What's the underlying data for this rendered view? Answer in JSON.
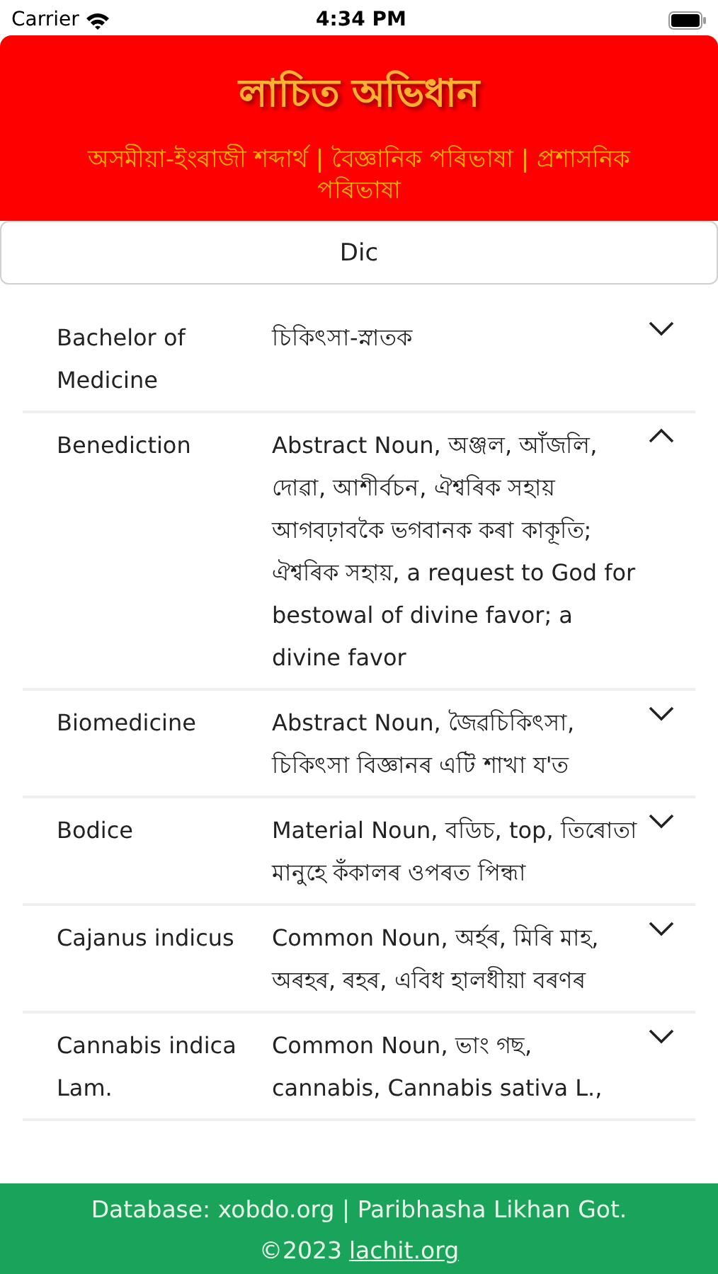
{
  "status_bar": {
    "carrier": "Carrier",
    "time": "4:34 PM"
  },
  "header": {
    "title": "লাচিত অভিধান",
    "subtitle": "অসমীয়া-ইংৰাজী শব্দাৰ্থ | বৈজ্ঞানিক পৰিভাষা | প্ৰশাসনিক পৰিভাষা"
  },
  "mode_button": {
    "label": "Dic"
  },
  "entries": [
    {
      "term": "Bachelor of Medicine",
      "definition": "চিকিৎসা-স্নাতক",
      "expanded": false
    },
    {
      "term": "Benediction",
      "definition": "Abstract Noun, অঞ্জল, আঁজলি, দোৱা, আশীৰ্বচন, ঐশ্বৰিক সহায় আগবঢ়াবকৈ ভগবানক কৰা কাকূতি; ঐশ্বৰিক সহায়, a request to God for bestowal of divine favor; a divine favor",
      "expanded": true
    },
    {
      "term": "Biomedicine",
      "definition": "Abstract Noun, জৈৱচিকিৎসা, চিকিৎসা বিজ্ঞানৰ এটি শাখা য'ত",
      "expanded": false
    },
    {
      "term": "Bodice",
      "definition": "Material Noun, বডিচ, top, তিৰোতা মানুহে কঁকালৰ ওপৰত পিন্ধা",
      "expanded": false
    },
    {
      "term": "Cajanus indicus",
      "definition": "Common Noun, অৰ্হৰ, মিৰি মাহ, অৰহৰ, ৰহৰ, এবিধ হালধীয়া বৰণৰ",
      "expanded": false
    },
    {
      "term": "Cannabis indica Lam.",
      "definition": "Common Noun, ভাং গছ, cannabis, Cannabis sativa L.,",
      "expanded": false
    }
  ],
  "footer": {
    "text": "Database: xobdo.org | Paribhasha Likhan Got.",
    "copyright": "©2023",
    "link": "lachit.org"
  }
}
